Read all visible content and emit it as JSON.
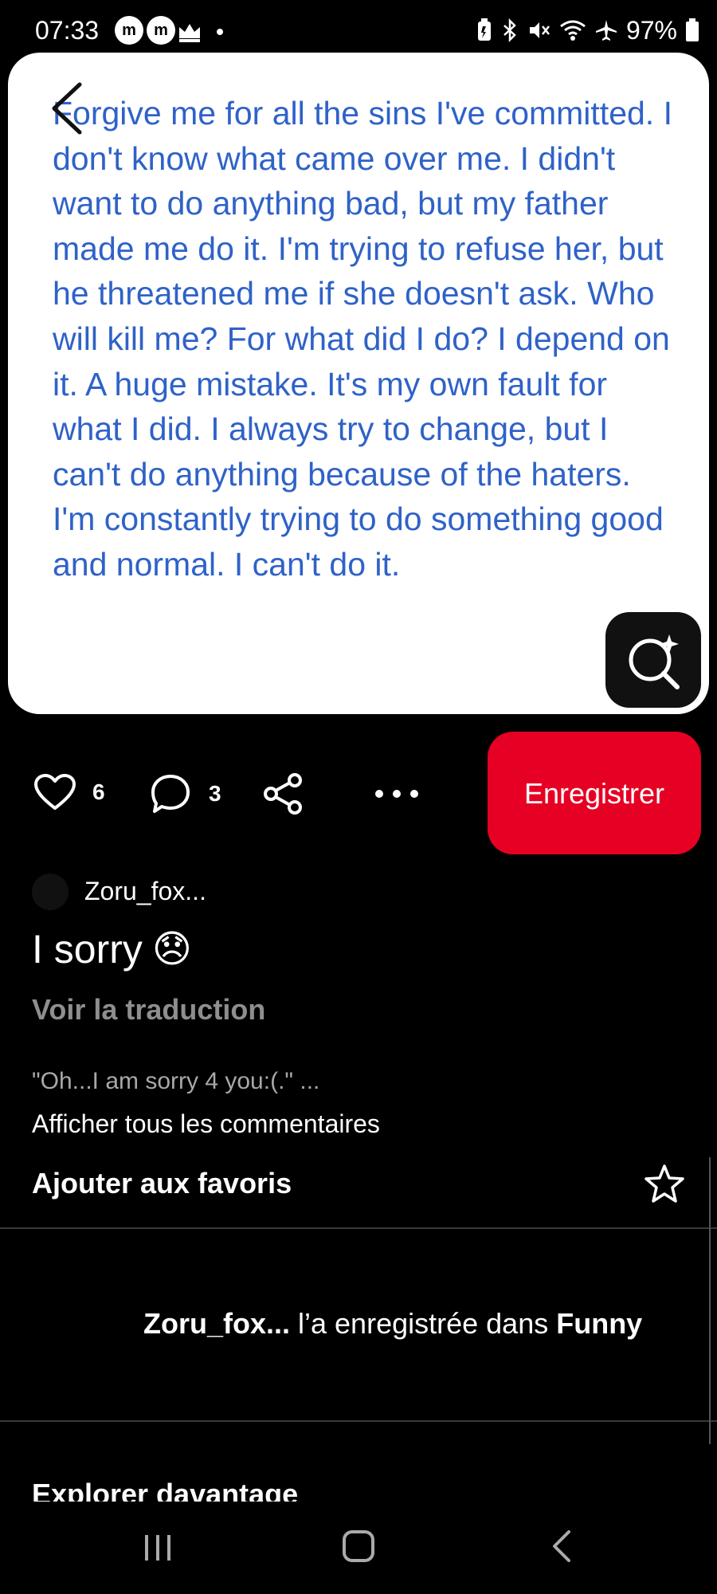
{
  "status_bar": {
    "time": "07:33",
    "app_icons": [
      "m",
      "m"
    ],
    "battery": "97%"
  },
  "pin": {
    "text": "Forgive me for all the sins I've committed. I don't know what came over me. I didn't want to do anything bad, but my father made me do it. I'm trying to refuse her, but he threatened me if she doesn't ask. Who will kill me? For what did I do? I depend on it. A huge mistake. It's my own fault for what I did. I always try to change, but I can't do anything because of the haters. I'm constantly trying to do something good and normal. I can't do it."
  },
  "actions": {
    "like_count": "6",
    "comment_count": "3",
    "save_label": "Enregistrer"
  },
  "author": {
    "name": "Zoru_fox..."
  },
  "details": {
    "title": "I sorry",
    "title_emoji": "😞",
    "translate_label": "Voir la traduction",
    "comment_preview": "\"Oh...I am sorry 4 you:(.\" ...",
    "all_comments_label": "Afficher tous les commentaires",
    "favorites_label": "Ajouter aux favoris"
  },
  "saved_activity": {
    "user": "Zoru_fox...",
    "text": " l’a enregistrée dans ",
    "board": "Funny"
  },
  "explore": {
    "heading": "Explorer davantage"
  },
  "colors": {
    "accent": "#e60023",
    "pin_text": "#2f62c8",
    "background": "#000000"
  },
  "icons": [
    "back-icon",
    "visual-search-icon",
    "heart-icon",
    "comment-icon",
    "share-icon",
    "more-icon",
    "star-icon"
  ]
}
